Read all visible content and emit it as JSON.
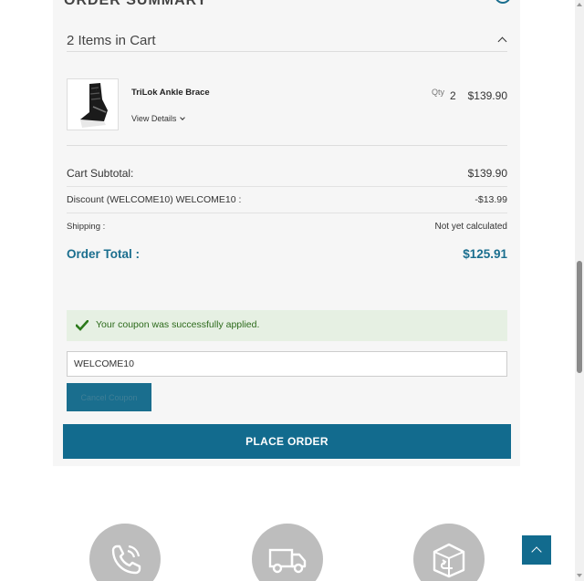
{
  "order_summary": {
    "heading": "ORDER SUMMARY",
    "items_count": "2 Items in Cart"
  },
  "product": {
    "name": "TriLok Ankle Brace",
    "view_details": "View Details",
    "qty_label": "Qty",
    "qty": "2",
    "price": "$139.90"
  },
  "totals": {
    "subtotal_label": "Cart Subtotal:",
    "subtotal_value": "$139.90",
    "discount_label": "Discount (WELCOME10) WELCOME10 :",
    "discount_value": "-$13.99",
    "shipping_label": "Shipping :",
    "shipping_value": "Not yet calculated",
    "total_label": "Order Total :",
    "total_value": "$125.91"
  },
  "coupon": {
    "success_message": "Your coupon was successfully applied.",
    "input_value": "WELCOME10",
    "cancel_label": "Cancel Coupon"
  },
  "place_order_label": "PLACE ORDER",
  "features": [
    {
      "icon": "phone-icon"
    },
    {
      "icon": "truck-icon"
    },
    {
      "icon": "return-box-icon"
    }
  ],
  "colors": {
    "accent": "#126b8e",
    "success_bg": "#e6f0e3",
    "success_text": "#2c6a1b",
    "panel_bg": "#f6f6f6"
  }
}
